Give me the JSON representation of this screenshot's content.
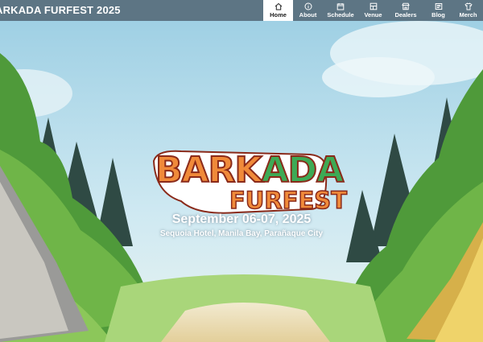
{
  "site": {
    "title": "ARKADA FURFEST 2025"
  },
  "nav": {
    "items": [
      {
        "label": "Home",
        "icon": "home-icon",
        "active": true
      },
      {
        "label": "About",
        "icon": "info-icon"
      },
      {
        "label": "Schedule",
        "icon": "calendar-icon"
      },
      {
        "label": "Venue",
        "icon": "map-icon"
      },
      {
        "label": "Dealers",
        "icon": "store-icon"
      },
      {
        "label": "Blog",
        "icon": "news-icon"
      },
      {
        "label": "Merch",
        "icon": "shirt-icon"
      }
    ]
  },
  "hero": {
    "logo_word1_a": "BARK",
    "logo_word1_b": "ADA",
    "logo_word2": "FURFEST",
    "date": "September 06-07, 2025",
    "venue": "Sequoia Hotel, Manila Bay, Parañaque City"
  },
  "colors": {
    "navbar": "#5d7584",
    "logo_orange": "#f08a3a",
    "logo_green": "#3daa55",
    "logo_outline": "#8a2a1a"
  }
}
